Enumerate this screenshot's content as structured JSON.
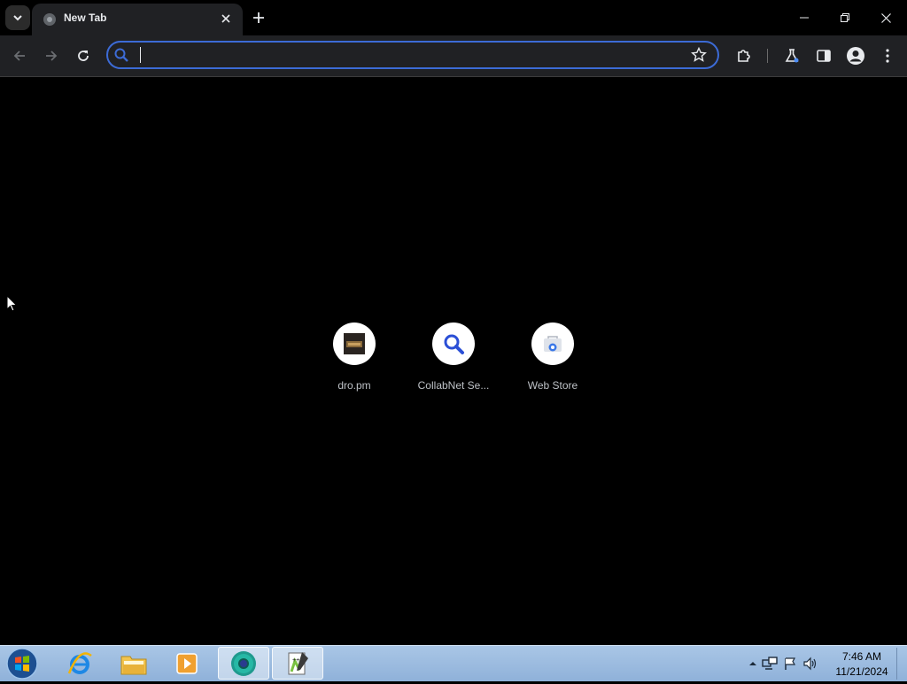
{
  "browser": {
    "tab": {
      "title": "New Tab"
    },
    "omnibox": {
      "value": "",
      "placeholder": ""
    }
  },
  "shortcuts": [
    {
      "label": "dro.pm"
    },
    {
      "label": "CollabNet Se..."
    },
    {
      "label": "Web Store"
    }
  ],
  "taskbar": {
    "apps": [
      "internet-explorer",
      "windows-explorer",
      "media-player",
      "chrome-canary",
      "notepad-plus-plus"
    ],
    "clock": {
      "time": "7:46 AM",
      "date": "11/21/2024"
    }
  },
  "colors": {
    "accent": "#3c6bd6",
    "background": "#000000",
    "toolbar": "#202124"
  }
}
